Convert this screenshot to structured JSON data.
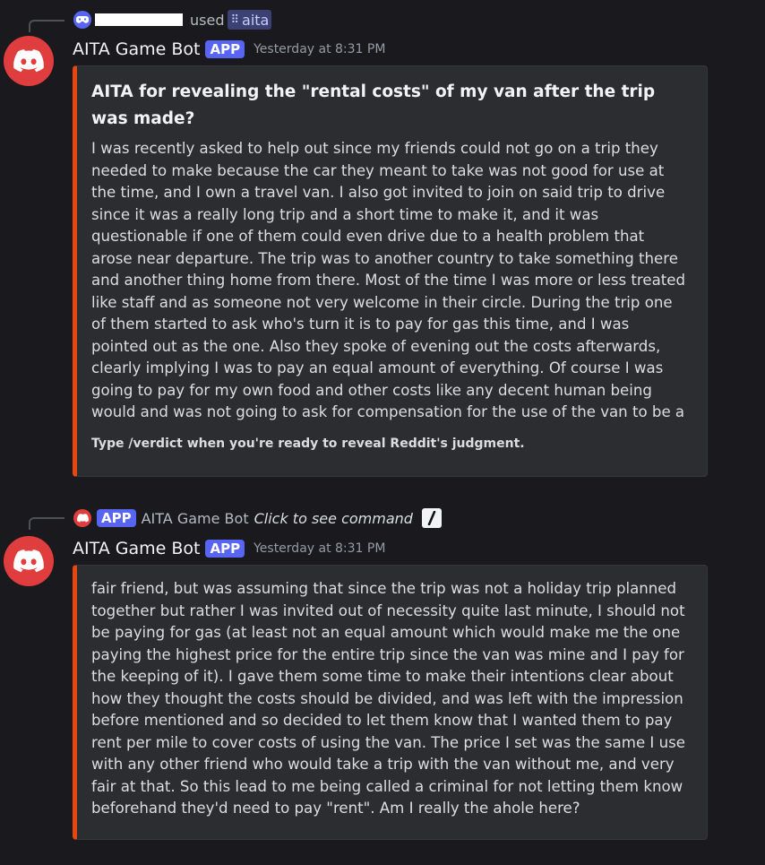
{
  "message1": {
    "reply": {
      "used_text": "used",
      "command_name": "aita"
    },
    "author": "AITA Game Bot",
    "badge": "APP",
    "timestamp": "Yesterday at 8:31 PM",
    "embed": {
      "title": "AITA for revealing the \"rental costs\" of my van after the trip was made?",
      "description": "I was recently asked to help out since my friends could not go on a trip they needed to make because the car they meant to take was not good for use at the time, and I own a travel van. I also got invited to join on said trip to drive since it was a really long trip and a short time to make it, and it was questionable if one of them could even drive due to a health problem that arose near departure. The trip was to another country to take something there and another thing home from there. Most of the time I was more or less treated like staff and as someone not very welcome in their circle. During the trip one of them started to ask who's turn it is to pay for gas this time, and I was pointed out as the one. Also they spoke of evening out the costs afterwards, clearly implying I was to pay an equal amount of everything. Of course I was going to pay for my own food and other costs like any decent human being would and was not going to ask for compensation for the use of the van to be a",
      "footer": "Type /verdict when you're ready to reveal Reddit's judgment."
    }
  },
  "message2": {
    "reply": {
      "badge": "APP",
      "author": "AITA Game Bot",
      "prompt": "Click to see command"
    },
    "author": "AITA Game Bot",
    "badge": "APP",
    "timestamp": "Yesterday at 8:31 PM",
    "embed": {
      "description": "fair friend, but was assuming that since the trip was not a holiday trip planned together but rather I was invited out of necessity quite last minute, I should not be paying for gas (at least not an equal amount which would make me the one paying the highest price for the entire trip since the van was mine and I pay for the keeping of it). I gave them some time to make their intentions clear about how they thought the costs should be divided, and was left with the impression before mentioned and so decided to let them know that I wanted them to pay rent per mile to cover costs of using the van. The price I set was the same I use with any other friend who would take a trip with the van without me, and very fair at that. So this lead to me being called a criminal for not letting them know beforehand they'd need to pay \"rent\". Am I really the ahole here?"
    }
  },
  "colors": {
    "background": "#1a1a1e",
    "embed_bg": "#2b2d31",
    "embed_accent": "#e5470e",
    "app_badge": "#5865f2",
    "avatar": "#e03e3e"
  },
  "icons": [
    "discord-logo-icon",
    "controller-icon",
    "slash-command-icon",
    "app-grid-icon"
  ]
}
